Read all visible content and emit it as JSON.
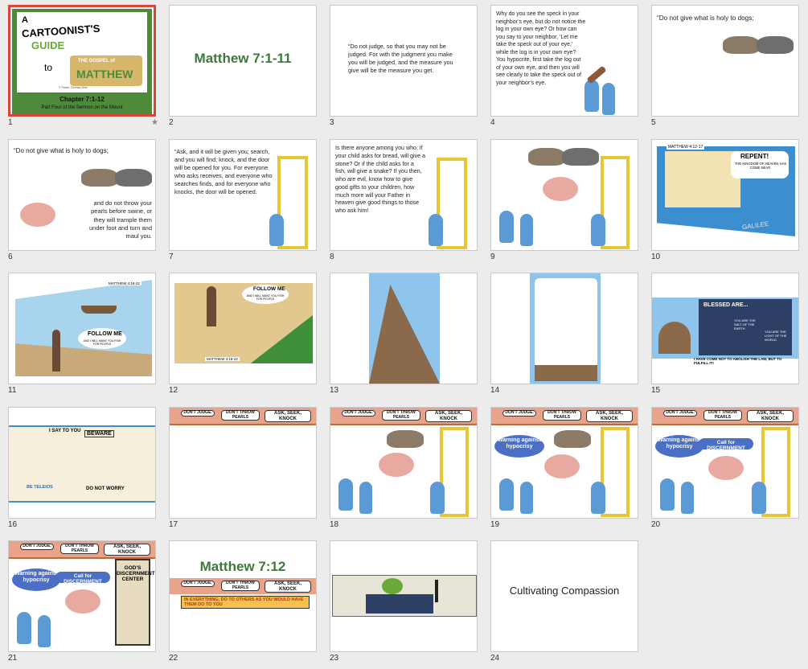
{
  "slides": [
    {
      "num": "1",
      "title_line1": "A",
      "title_line2": "CARTOONIST'S",
      "title_line3": "GUIDE",
      "title_to": "to",
      "book_small": "THE GOSPEL of",
      "book_big": "MATTHEW",
      "credit": "© Pastor Thomas Shim",
      "chapter": "Chapter 7:1-12",
      "subtitle": "Part Four of the Sermon on the Mount",
      "star": "★"
    },
    {
      "num": "2",
      "heading": "Matthew 7:1-11"
    },
    {
      "num": "3",
      "text": "“Do not judge, so that you may not be judged. For with the judgment you make you will be judged, and the measure you give will be the measure you get."
    },
    {
      "num": "4",
      "text": "Why do you see the speck in your neighbor’s eye, but do not notice the log in your own eye? Or how can you say to your neighbor, ‘Let me take the speck out of your eye,’ while the log is in your own eye? You hypocrite, first take the log out of your own eye, and then you will see clearly to take the speck out of your neighbor’s eye."
    },
    {
      "num": "5",
      "text": "“Do not give what is holy to dogs;"
    },
    {
      "num": "6",
      "text1": "“Do not give what is holy to dogs;",
      "text2": "and do not throw your pearls before swine, or they will trample them under foot and turn and maul you."
    },
    {
      "num": "7",
      "text": "“Ask, and it will be given you; search, and you will find; knock, and the door will be opened for you. For everyone who asks receives, and everyone who searches finds, and for everyone who knocks, the door will be opened."
    },
    {
      "num": "8",
      "text": "Is there anyone among you who, if your child asks for bread, will give a stone? Or if the child asks for a fish, will give a snake? If you then, who are evil, know how to give good gifts to your children, how much more will your Father in heaven give good things to those who ask him!"
    },
    {
      "num": "9"
    },
    {
      "num": "10",
      "ref": "MATTHEW 4:12-17",
      "repent": "REPENT!",
      "repent_sub": "THE KINGDOM OF HEAVEN HAS COME NEAR.",
      "place": "GALILEE"
    },
    {
      "num": "11",
      "ref": "MATTHEW 4:18-22",
      "follow": "FOLLOW ME",
      "follow_sub": "AND I WILL MAKE YOU FISH FOR PEOPLE"
    },
    {
      "num": "12",
      "follow": "FOLLOW ME",
      "follow_sub": "AND I WILL MAKE YOU FISH FOR PEOPLE",
      "ref": "MATTHEW 4:18-22"
    },
    {
      "num": "13"
    },
    {
      "num": "14"
    },
    {
      "num": "15",
      "blessed": "BLESSED ARE...",
      "salt": "YOU ARE THE SALT OF THE EARTH",
      "light": "YOU ARE THE LIGHT OF THE WORLD",
      "fulfill": "I HAVE COME NOT TO ABOLISH THE LAW, BUT TO FULFILL IT!"
    },
    {
      "num": "16",
      "isay": "I SAY TO YOU",
      "beware": "BEWARE",
      "donot": "DO NOT WORRY",
      "be": "BE TELEIOS"
    },
    {
      "num": "17",
      "b1": "DON'T JUDGE,",
      "b2": "DON'T THROW PEARLS",
      "b3": "ASK, SEEK, KNOCK"
    },
    {
      "num": "18",
      "b1": "DON'T JUDGE,",
      "b2": "DON'T THROW PEARLS",
      "b3": "ASK, SEEK, KNOCK"
    },
    {
      "num": "19",
      "b1": "DON'T JUDGE,",
      "b2": "DON'T THROW PEARLS",
      "b3": "ASK, SEEK, KNOCK",
      "warn": "Warning against hypocrisy"
    },
    {
      "num": "20",
      "b1": "DON'T JUDGE,",
      "b2": "DON'T THROW PEARLS",
      "b3": "ASK, SEEK, KNOCK",
      "warn": "Warning against hypocrisy",
      "disc": "Call for DISCERNMENT"
    },
    {
      "num": "21",
      "b1": "DON'T JUDGE,",
      "b2": "DON'T THROW PEARLS",
      "b3": "ASK, SEEK, KNOCK",
      "warn": "Warning against hypocrisy",
      "disc": "Call for DISCERNMENT",
      "center": "GOD'S DISCERNMENT CENTER"
    },
    {
      "num": "22",
      "heading": "Matthew 7:12",
      "b1": "DON'T JUDGE,",
      "b2": "DON'T THROW PEARLS",
      "b3": "ASK, SEEK, KNOCK",
      "golden": "IN EVERYTHING, DO TO OTHERS AS YOU WOULD HAVE THEM DO TO YOU"
    },
    {
      "num": "23"
    },
    {
      "num": "24",
      "heading": "Cultivating Compassion"
    }
  ],
  "colors": {
    "selected": "#d9453a",
    "green_title": "#3c7a3c",
    "accent_blue": "#5b9bd5",
    "door": "#e6c634",
    "warn": "#4a6fc4"
  }
}
